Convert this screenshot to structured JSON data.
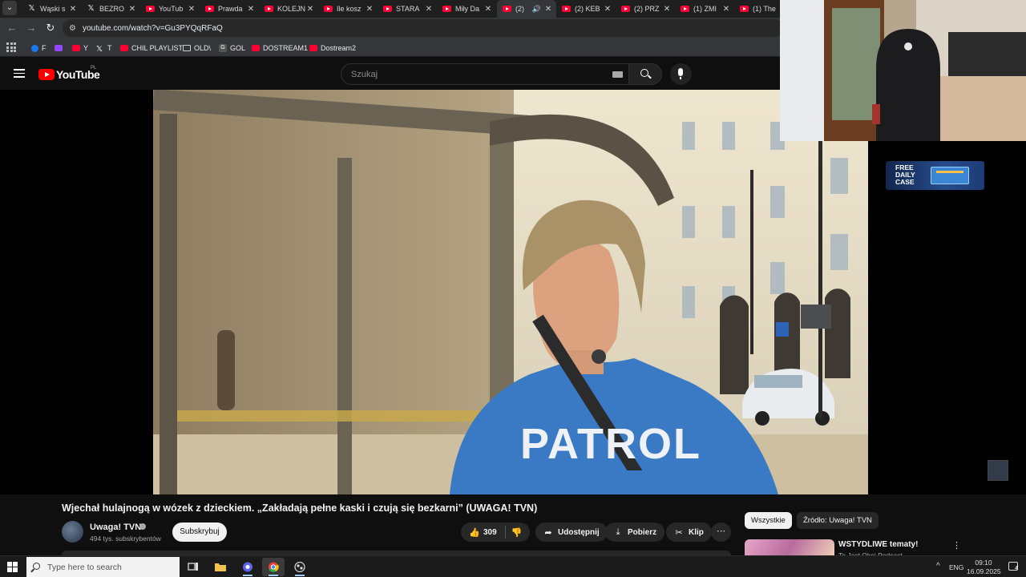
{
  "browser": {
    "tabs": [
      {
        "title": "Wąski s",
        "icon": "x-icon"
      },
      {
        "title": "BEZRO",
        "icon": "x-icon"
      },
      {
        "title": "YouTub",
        "icon": "youtube-icon"
      },
      {
        "title": "Prawda",
        "icon": "youtube-icon"
      },
      {
        "title": "KOLEJN",
        "icon": "youtube-icon"
      },
      {
        "title": "Ile kosz",
        "icon": "youtube-icon"
      },
      {
        "title": "STARA",
        "icon": "youtube-icon"
      },
      {
        "title": "Miły Da",
        "icon": "youtube-icon"
      },
      {
        "title": "(2) ",
        "icon": "youtube-icon",
        "active": true
      },
      {
        "title": "(2) KEB",
        "icon": "youtube-icon"
      },
      {
        "title": "(2) PRZ",
        "icon": "youtube-icon"
      },
      {
        "title": "(1) ZMI",
        "icon": "youtube-icon"
      },
      {
        "title": "(1) The",
        "icon": "youtube-icon"
      }
    ],
    "url": "youtube.com/watch?v=Gu3PYQqRFaQ",
    "bookmarks": [
      {
        "label": "F",
        "icon": "facebook-icon"
      },
      {
        "label": "Y",
        "icon": "youtube-icon"
      },
      {
        "label": "T",
        "icon": "x-icon"
      },
      {
        "label": "CHIL PLAYLIST",
        "icon": "youtube-icon"
      },
      {
        "label": "OLD\\",
        "icon": "folder-icon"
      },
      {
        "label": "GOL",
        "icon": "g-icon"
      },
      {
        "label": "DOSTREAM1",
        "icon": "youtube-icon"
      },
      {
        "label": "Dostream2",
        "icon": "youtube-icon"
      }
    ]
  },
  "youtube": {
    "logo_text": "YouTube",
    "country_code": "PL",
    "search_placeholder": "Szukaj",
    "ad_banner": {
      "text": "FREE DAILY CASE"
    },
    "video": {
      "title": "Wjechał hulajnogą w wózek z dzieckiem. „Zakładają pełne kaski i czują się bezkarni” (UWAGA! TVN)",
      "channel": "Uwaga! TVN",
      "subscribers": "494 tys. subskrybentów",
      "subscribe_label": "Subskrybuj",
      "likes": "309",
      "share_label": "Udostępnij",
      "download_label": "Pobierz",
      "clip_label": "Klip",
      "shirt_text": "PATROL"
    },
    "filters": {
      "all": "Wszystkie",
      "source": "Źródło: Uwaga! TVN"
    },
    "recommended": [
      {
        "title": "WSTYDLIWE tematy!",
        "channel": "To Jest Okej Podcast"
      }
    ]
  },
  "taskbar": {
    "search_placeholder": "Type here to search",
    "lang": "ENG",
    "time": "09:10",
    "date": "16.09.2025",
    "notifications": "4"
  },
  "colors": {
    "youtube_red": "#ff0000",
    "bg": "#0f0f0f",
    "pill": "#272727"
  }
}
